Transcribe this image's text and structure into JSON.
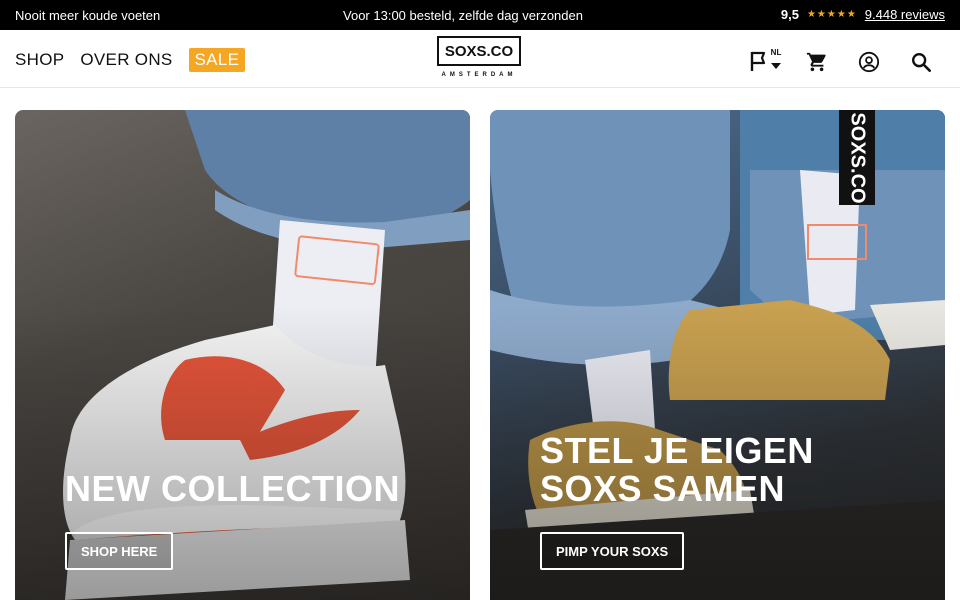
{
  "topbar": {
    "left": "Nooit meer koude voeten",
    "center": "Voor 13:00 besteld, zelfde dag verzonden",
    "score": "9,5",
    "stars": "★★★★★",
    "reviews": "9.448 reviews"
  },
  "nav": {
    "shop": "SHOP",
    "about": "OVER ONS",
    "sale": "SALE"
  },
  "logo": {
    "name": "SOXS.CO",
    "sub": "AMSTERDAM"
  },
  "actions": {
    "language": "NL",
    "icons": [
      "flag-icon",
      "cart-icon",
      "account-icon",
      "search-icon"
    ]
  },
  "hero": {
    "left": {
      "title": "NEW COLLECTION",
      "cta": "SHOP HERE"
    },
    "right": {
      "title_line1": "STEL JE EIGEN",
      "title_line2": "SOXS SAMEN",
      "cta": "PIMP YOUR SOXS",
      "badge": "SOXS.CO"
    }
  },
  "colors": {
    "accent": "#f5a623",
    "topbar_bg": "#000000"
  }
}
